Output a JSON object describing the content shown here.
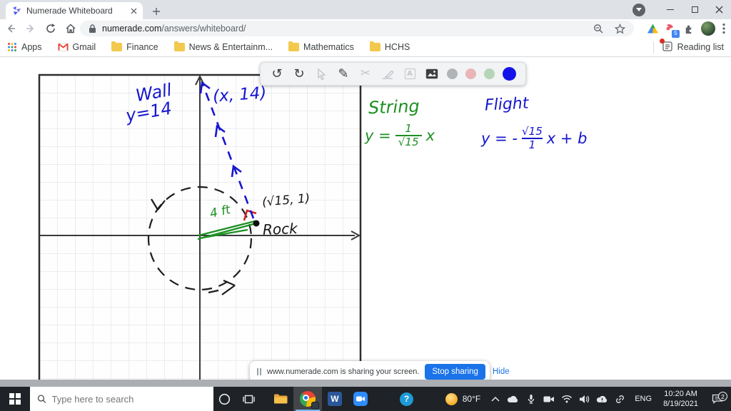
{
  "browser": {
    "tab_title": "Numerade Whiteboard",
    "url_host": "numerade.com",
    "url_path": "/answers/whiteboard/",
    "bookmarks": [
      "Apps",
      "Gmail",
      "Finance",
      "News & Entertainm...",
      "Mathematics",
      "HCHS"
    ],
    "reading_list_label": "Reading list",
    "extension_badge": "5"
  },
  "whiteboard": {
    "palette": [
      "#b1b4b6",
      "#eab5b7",
      "#b6d5b7",
      "#1414e8"
    ],
    "toolbar": {
      "text_tool_glyph": "A"
    },
    "ink": {
      "wall_label": "Wall",
      "wall_equation": "y=14",
      "top_point": "(x, 14)",
      "string_label": "String",
      "string_eq_lhs": "y =",
      "string_eq_numerator": "1",
      "string_eq_denominator": "√15",
      "string_eq_rhs": "x",
      "flight_label": "Flight",
      "flight_eq_lhs": "y = -",
      "flight_eq_numerator": "√15",
      "flight_eq_denominator": "1",
      "flight_eq_rhs": "x + b",
      "rock_point": "(√15, 1)",
      "rock_label": "Rock",
      "radius_label": "4 ft"
    }
  },
  "share_bar": {
    "message": "www.numerade.com is sharing your screen.",
    "stop_button": "Stop sharing",
    "hide_link": "Hide"
  },
  "taskbar": {
    "search_placeholder": "Type here to search",
    "word_glyph": "W",
    "help_glyph": "?",
    "weather_temp": "80°F",
    "language": "ENG",
    "time": "10:20 AM",
    "date": "8/19/2021",
    "notification_badge": "2"
  }
}
